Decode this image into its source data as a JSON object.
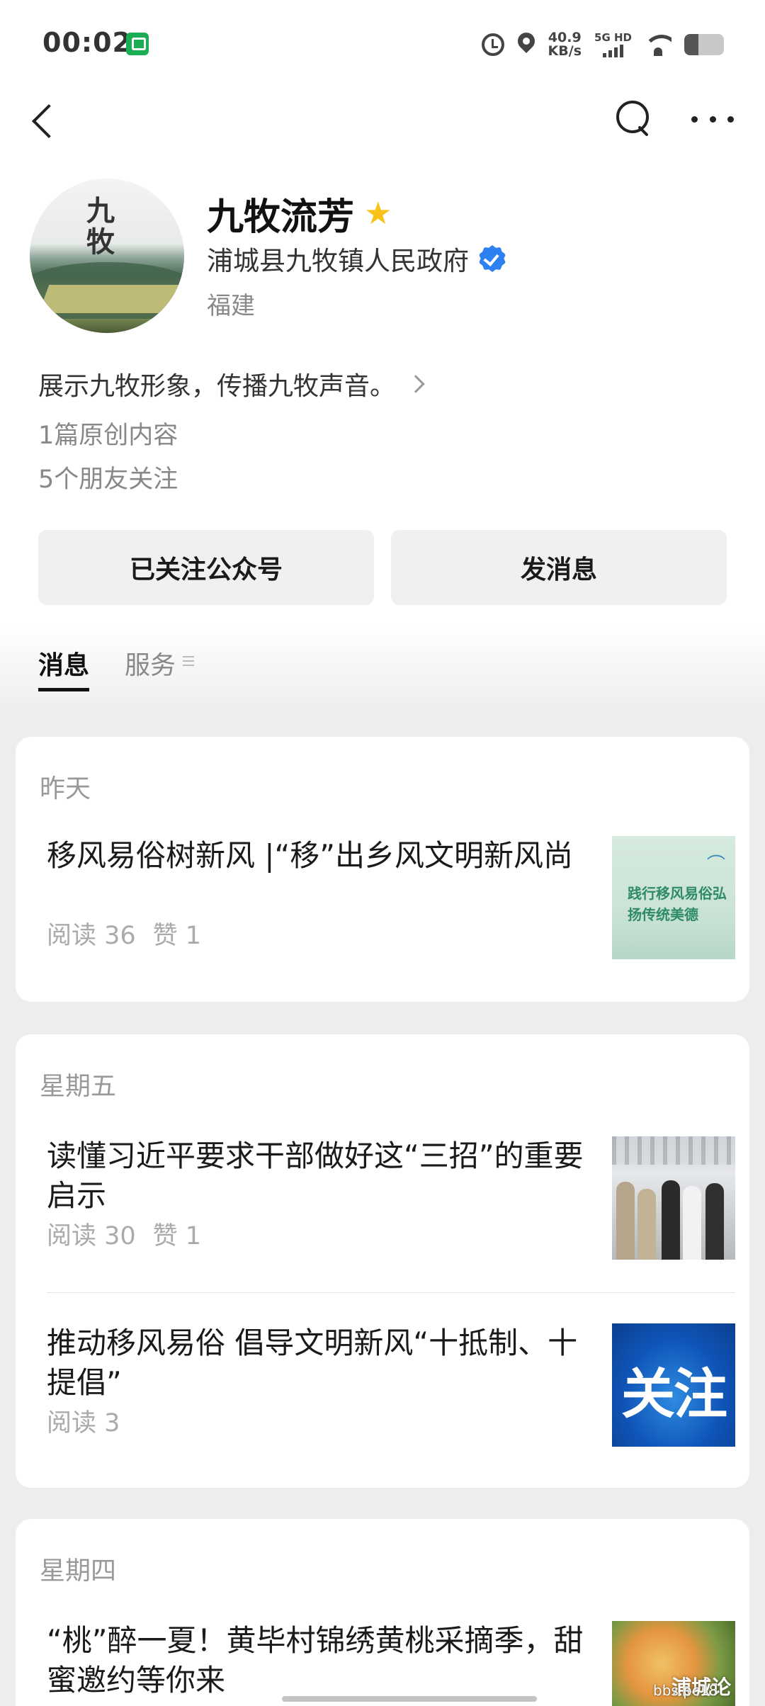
{
  "status_bar": {
    "time": "00:02",
    "speed_value": "40.9",
    "speed_unit": "KB/s",
    "network": "5G HD",
    "battery_percent": 35
  },
  "profile": {
    "avatar_text": "九牧",
    "name": "九牧流芳",
    "organization": "浦城县九牧镇人民政府",
    "region": "福建",
    "description": "展示九牧形象，传播九牧声音。",
    "original_count": "1篇原创内容",
    "friends_following": "5个朋友关注"
  },
  "actions": {
    "follow_label": "已关注公众号",
    "message_label": "发消息"
  },
  "tabs": [
    {
      "label": "消息"
    },
    {
      "label": "服务"
    }
  ],
  "feed": [
    {
      "date": "昨天",
      "articles": [
        {
          "title": "移风易俗树新风 |“移”出乡风文明新风尚",
          "reads": "阅读 36",
          "likes": "赞 1",
          "thumb_text": "践行移风易俗弘扬传统美德"
        }
      ]
    },
    {
      "date": "星期五",
      "articles": [
        {
          "title": "读懂习近平要求干部做好这“三招”的重要启示",
          "reads": "阅读 30",
          "likes": "赞 1"
        },
        {
          "title": "推动移风易俗 倡导文明新风“十抵制、十提倡”",
          "reads": "阅读 3",
          "thumb_text": "关注"
        }
      ]
    },
    {
      "date": "星期四",
      "articles": [
        {
          "title": "“桃”醉一夏！黄毕村锦绣黄桃采摘季，甜蜜邀约等你来",
          "thumb_watermark": "浦城论"
        }
      ]
    }
  ],
  "watermark_url": "bbs.pc18"
}
